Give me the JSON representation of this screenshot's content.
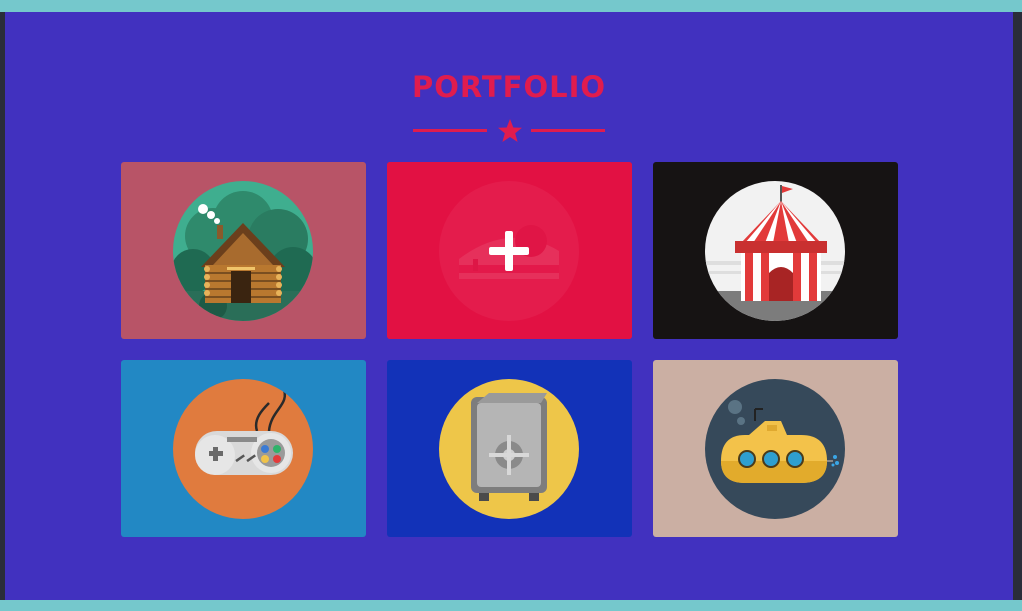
{
  "page": {
    "title": "PORTFOLIO",
    "colors": {
      "accent": "#e01c4e",
      "section_bg": "#4131bf",
      "frame": "#75c8cc"
    }
  },
  "portfolio": {
    "items": [
      {
        "name": "cabin",
        "icon": "log-cabin-icon",
        "bg": "#b85467",
        "disc": "#2e7a5e"
      },
      {
        "name": "cake",
        "icon": "cake-icon",
        "bg": "#e21245",
        "hovered": true
      },
      {
        "name": "circus",
        "icon": "circus-tent-icon",
        "bg": "#161313",
        "disc": "#f2f2f2"
      },
      {
        "name": "game",
        "icon": "gamepad-icon",
        "bg": "#2288c4",
        "disc": "#e07b3e"
      },
      {
        "name": "safe",
        "icon": "safe-icon",
        "bg": "#1232b8",
        "disc": "#eec649"
      },
      {
        "name": "submarine",
        "icon": "submarine-icon",
        "bg": "#cbafa3",
        "disc": "#36495a"
      }
    ]
  }
}
